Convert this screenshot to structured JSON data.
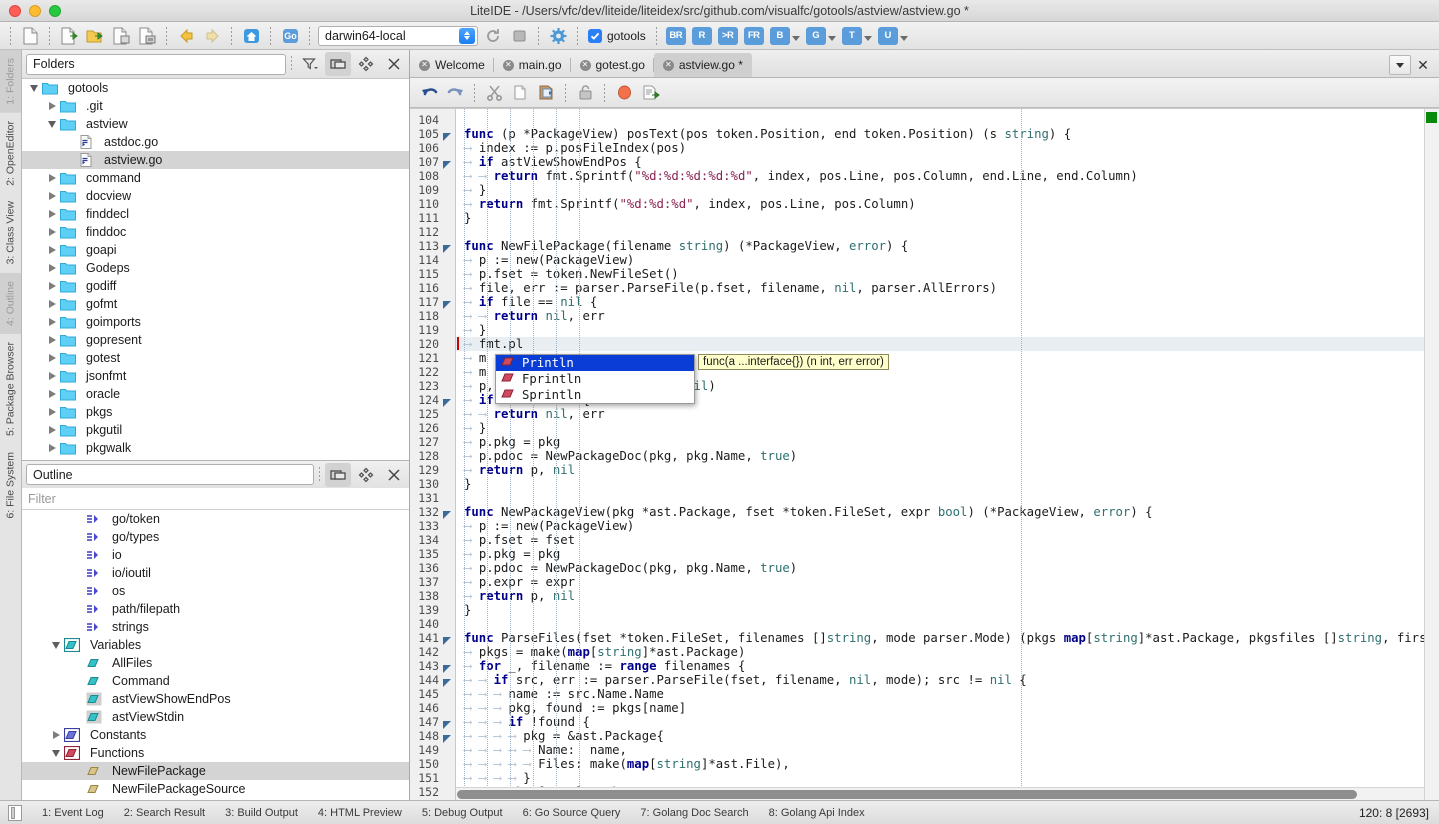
{
  "window": {
    "title": "LiteIDE - /Users/vfc/dev/liteide/liteidex/src/github.com/visualfc/gotools/astview/astview.go *"
  },
  "main_toolbar": {
    "buttons": [
      {
        "name": "new-file",
        "icon": "new-file-icon"
      },
      {
        "name": "open-file",
        "icon": "open-file-icon"
      },
      {
        "name": "open-folder",
        "icon": "open-folder-icon"
      },
      {
        "name": "save-file",
        "icon": "save-file-icon"
      },
      {
        "name": "save-all",
        "icon": "save-all-icon"
      },
      {
        "name": "navigate-back",
        "icon": "arrow-left-icon"
      },
      {
        "name": "navigate-forward",
        "icon": "arrow-right-icon"
      },
      {
        "name": "home",
        "icon": "home-icon"
      },
      {
        "name": "go-tool",
        "icon": "go-icon"
      }
    ],
    "env_combo": {
      "value": "darwin64-local",
      "name": "build-environment-combo"
    },
    "reload_label": "reload",
    "stop_label": "stop",
    "config_label": "configure",
    "gotools_checkbox": {
      "label": "gotools",
      "checked": true
    },
    "go_buttons": [
      {
        "label": "BR",
        "name": "build-run-button",
        "dropdown": false
      },
      {
        "label": "R",
        "name": "run-button",
        "dropdown": false
      },
      {
        "label": ">R",
        "name": "run-cmd-button",
        "dropdown": false
      },
      {
        "label": "FR",
        "name": "file-run-button",
        "dropdown": false
      },
      {
        "label": "B",
        "name": "build-button",
        "dropdown": true
      },
      {
        "label": "G",
        "name": "go-button",
        "dropdown": true
      },
      {
        "label": "T",
        "name": "test-button",
        "dropdown": true
      },
      {
        "label": "U",
        "name": "update-button",
        "dropdown": true
      }
    ]
  },
  "left_tabs": [
    {
      "label": "1: Folders",
      "active": true
    },
    {
      "label": "2: OpenEditor",
      "active": false
    },
    {
      "label": "3: Class View",
      "active": false
    },
    {
      "label": "4: Outline",
      "active": true
    },
    {
      "label": "5: Package Browser",
      "active": false
    },
    {
      "label": "6: File System",
      "active": false
    }
  ],
  "folders_panel": {
    "combo_value": "Folders",
    "toolbar": [
      {
        "name": "filter-button",
        "icon": "filter-icon"
      },
      {
        "name": "split-button",
        "icon": "split-icon",
        "active": true
      },
      {
        "name": "locate-button",
        "icon": "locate-icon"
      },
      {
        "name": "close-button",
        "icon": "close-icon"
      }
    ],
    "tree": [
      {
        "label": "gotools",
        "type": "folder",
        "depth": 0,
        "state": "open",
        "selected": false
      },
      {
        "label": ".git",
        "type": "folder",
        "depth": 1,
        "state": "closed",
        "selected": false
      },
      {
        "label": "astview",
        "type": "folder",
        "depth": 1,
        "state": "open",
        "selected": false
      },
      {
        "label": "astdoc.go",
        "type": "gofile",
        "depth": 2,
        "state": "none",
        "selected": false
      },
      {
        "label": "astview.go",
        "type": "gofile",
        "depth": 2,
        "state": "none",
        "selected": true
      },
      {
        "label": "command",
        "type": "folder",
        "depth": 1,
        "state": "closed",
        "selected": false
      },
      {
        "label": "docview",
        "type": "folder",
        "depth": 1,
        "state": "closed",
        "selected": false
      },
      {
        "label": "finddecl",
        "type": "folder",
        "depth": 1,
        "state": "closed",
        "selected": false
      },
      {
        "label": "finddoc",
        "type": "folder",
        "depth": 1,
        "state": "closed",
        "selected": false
      },
      {
        "label": "goapi",
        "type": "folder",
        "depth": 1,
        "state": "closed",
        "selected": false
      },
      {
        "label": "Godeps",
        "type": "folder",
        "depth": 1,
        "state": "closed",
        "selected": false
      },
      {
        "label": "godiff",
        "type": "folder",
        "depth": 1,
        "state": "closed",
        "selected": false
      },
      {
        "label": "gofmt",
        "type": "folder",
        "depth": 1,
        "state": "closed",
        "selected": false
      },
      {
        "label": "goimports",
        "type": "folder",
        "depth": 1,
        "state": "closed",
        "selected": false
      },
      {
        "label": "gopresent",
        "type": "folder",
        "depth": 1,
        "state": "closed",
        "selected": false
      },
      {
        "label": "gotest",
        "type": "folder",
        "depth": 1,
        "state": "closed",
        "selected": false
      },
      {
        "label": "jsonfmt",
        "type": "folder",
        "depth": 1,
        "state": "closed",
        "selected": false
      },
      {
        "label": "oracle",
        "type": "folder",
        "depth": 1,
        "state": "closed",
        "selected": false
      },
      {
        "label": "pkgs",
        "type": "folder",
        "depth": 1,
        "state": "closed",
        "selected": false
      },
      {
        "label": "pkgutil",
        "type": "folder",
        "depth": 1,
        "state": "closed",
        "selected": false
      },
      {
        "label": "pkgwalk",
        "type": "folder",
        "depth": 1,
        "state": "closed",
        "selected": false
      }
    ]
  },
  "outline_panel": {
    "combo_value": "Outline",
    "filter_placeholder": "Filter",
    "toolbar": [
      {
        "name": "split-button",
        "icon": "split-icon",
        "active": true
      },
      {
        "name": "locate-button",
        "icon": "locate-icon"
      },
      {
        "name": "close-button",
        "icon": "close-icon"
      }
    ],
    "tree": [
      {
        "label": "go/token",
        "type": "import",
        "depth": 2,
        "state": "none",
        "selected": false
      },
      {
        "label": "go/types",
        "type": "import",
        "depth": 2,
        "state": "none",
        "selected": false
      },
      {
        "label": "io",
        "type": "import",
        "depth": 2,
        "state": "none",
        "selected": false
      },
      {
        "label": "io/ioutil",
        "type": "import",
        "depth": 2,
        "state": "none",
        "selected": false
      },
      {
        "label": "os",
        "type": "import",
        "depth": 2,
        "state": "none",
        "selected": false
      },
      {
        "label": "path/filepath",
        "type": "import",
        "depth": 2,
        "state": "none",
        "selected": false
      },
      {
        "label": "strings",
        "type": "import",
        "depth": 2,
        "state": "none",
        "selected": false
      },
      {
        "label": "Variables",
        "type": "group-var",
        "depth": 1,
        "state": "open",
        "selected": false
      },
      {
        "label": "AllFiles",
        "type": "var",
        "depth": 2,
        "state": "none",
        "selected": false
      },
      {
        "label": "Command",
        "type": "var",
        "depth": 2,
        "state": "none",
        "selected": false
      },
      {
        "label": "astViewShowEndPos",
        "type": "var-private",
        "depth": 2,
        "state": "none",
        "selected": false
      },
      {
        "label": "astViewStdin",
        "type": "var-private",
        "depth": 2,
        "state": "none",
        "selected": false
      },
      {
        "label": "Constants",
        "type": "group-const",
        "depth": 1,
        "state": "closed",
        "selected": false
      },
      {
        "label": "Functions",
        "type": "group-func",
        "depth": 1,
        "state": "open",
        "selected": false
      },
      {
        "label": "NewFilePackage",
        "type": "func",
        "depth": 2,
        "state": "none",
        "selected": true
      },
      {
        "label": "NewFilePackageSource",
        "type": "func",
        "depth": 2,
        "state": "none",
        "selected": false
      }
    ]
  },
  "editor": {
    "tabs": [
      {
        "label": "Welcome",
        "active": false,
        "modified": false
      },
      {
        "label": "main.go",
        "active": false,
        "modified": false
      },
      {
        "label": "gotest.go",
        "active": false,
        "modified": false
      },
      {
        "label": "astview.go *",
        "active": true,
        "modified": true
      }
    ],
    "tab_list_button": "tab-list-button",
    "tab_close_button": "close-tab-button",
    "toolbar": [
      {
        "name": "undo-button",
        "icon": "undo-icon"
      },
      {
        "name": "redo-button",
        "icon": "redo-icon"
      },
      {
        "name": "cut-button",
        "icon": "cut-icon"
      },
      {
        "name": "copy-button",
        "icon": "copy-icon"
      },
      {
        "name": "paste-button",
        "icon": "paste-icon"
      },
      {
        "name": "lock-button",
        "icon": "unlock-icon"
      },
      {
        "name": "bookmark-button",
        "icon": "bookmark-icon"
      },
      {
        "name": "export-button",
        "icon": "export-icon"
      }
    ],
    "first_line_number": 104,
    "current_line": 120,
    "lines": [
      {
        "n": 104,
        "text": "",
        "fold": false
      },
      {
        "n": 105,
        "text": "func (p *PackageView) posText(pos token.Position, end token.Position) (s string) {",
        "fold": true
      },
      {
        "n": 106,
        "text": "\tindex := p.posFileIndex(pos)",
        "fold": false
      },
      {
        "n": 107,
        "text": "\tif astViewShowEndPos {",
        "fold": true
      },
      {
        "n": 108,
        "text": "\t\treturn fmt.Sprintf(\"%d:%d:%d:%d:%d\", index, pos.Line, pos.Column, end.Line, end.Column)",
        "fold": false
      },
      {
        "n": 109,
        "text": "\t}",
        "fold": false
      },
      {
        "n": 110,
        "text": "\treturn fmt.Sprintf(\"%d:%d:%d\", index, pos.Line, pos.Column)",
        "fold": false
      },
      {
        "n": 111,
        "text": "}",
        "fold": false
      },
      {
        "n": 112,
        "text": "",
        "fold": false
      },
      {
        "n": 113,
        "text": "func NewFilePackage(filename string) (*PackageView, error) {",
        "fold": true
      },
      {
        "n": 114,
        "text": "\tp := new(PackageView)",
        "fold": false
      },
      {
        "n": 115,
        "text": "\tp.fset = token.NewFileSet()",
        "fold": false
      },
      {
        "n": 116,
        "text": "\tfile, err := parser.ParseFile(p.fset, filename, nil, parser.AllErrors)",
        "fold": false
      },
      {
        "n": 117,
        "text": "\tif file == nil {",
        "fold": true
      },
      {
        "n": 118,
        "text": "\t\treturn nil, err",
        "fold": false
      },
      {
        "n": 119,
        "text": "\t}",
        "fold": false
      },
      {
        "n": 120,
        "text": "\tfmt.pl",
        "fold": false
      },
      {
        "n": 121,
        "text": "\tm := ...",
        "fold": false
      },
      {
        "n": 122,
        "text": "\tm := ...",
        "fold": false
      },
      {
        "n": 123,
        "text": "\tp, err := ....fset, m, nil, nil)",
        "fold": false
      },
      {
        "n": 124,
        "text": "\tif err != nil {",
        "fold": true
      },
      {
        "n": 125,
        "text": "\t\treturn nil, err",
        "fold": false
      },
      {
        "n": 126,
        "text": "\t}",
        "fold": false
      },
      {
        "n": 127,
        "text": "\tp.pkg = pkg",
        "fold": false
      },
      {
        "n": 128,
        "text": "\tp.pdoc = NewPackageDoc(pkg, pkg.Name, true)",
        "fold": false
      },
      {
        "n": 129,
        "text": "\treturn p, nil",
        "fold": false
      },
      {
        "n": 130,
        "text": "}",
        "fold": false
      },
      {
        "n": 131,
        "text": "",
        "fold": false
      },
      {
        "n": 132,
        "text": "func NewPackageView(pkg *ast.Package, fset *token.FileSet, expr bool) (*PackageView, error) {",
        "fold": true
      },
      {
        "n": 133,
        "text": "\tp := new(PackageView)",
        "fold": false
      },
      {
        "n": 134,
        "text": "\tp.fset = fset",
        "fold": false
      },
      {
        "n": 135,
        "text": "\tp.pkg = pkg",
        "fold": false
      },
      {
        "n": 136,
        "text": "\tp.pdoc = NewPackageDoc(pkg, pkg.Name, true)",
        "fold": false
      },
      {
        "n": 137,
        "text": "\tp.expr = expr",
        "fold": false
      },
      {
        "n": 138,
        "text": "\treturn p, nil",
        "fold": false
      },
      {
        "n": 139,
        "text": "}",
        "fold": false
      },
      {
        "n": 140,
        "text": "",
        "fold": false
      },
      {
        "n": 141,
        "text": "func ParseFiles(fset *token.FileSet, filenames []string, mode parser.Mode) (pkgs map[string]*ast.Package, pkgsfiles []string, first e",
        "fold": true
      },
      {
        "n": 142,
        "text": "\tpkgs = make(map[string]*ast.Package)",
        "fold": false
      },
      {
        "n": 143,
        "text": "\tfor _, filename := range filenames {",
        "fold": true
      },
      {
        "n": 144,
        "text": "\t\tif src, err := parser.ParseFile(fset, filename, nil, mode); src != nil {",
        "fold": true
      },
      {
        "n": 145,
        "text": "\t\t\tname := src.Name.Name",
        "fold": false
      },
      {
        "n": 146,
        "text": "\t\t\tpkg, found := pkgs[name]",
        "fold": false
      },
      {
        "n": 147,
        "text": "\t\t\tif !found {",
        "fold": true
      },
      {
        "n": 148,
        "text": "\t\t\t\tpkg = &ast.Package{",
        "fold": true
      },
      {
        "n": 149,
        "text": "\t\t\t\t\tName:  name,",
        "fold": false
      },
      {
        "n": 150,
        "text": "\t\t\t\t\tFiles: make(map[string]*ast.File),",
        "fold": false
      },
      {
        "n": 151,
        "text": "\t\t\t\t}",
        "fold": false
      },
      {
        "n": 152,
        "text": "\t\t\tpkgs[name] = pkg",
        "fold": false
      }
    ],
    "autocomplete": {
      "items": [
        {
          "label": "Println",
          "selected": true
        },
        {
          "label": "Fprintln",
          "selected": false
        },
        {
          "label": "Sprintln",
          "selected": false
        }
      ],
      "tooltip": "func(a ...interface{}) (n int, err error)"
    }
  },
  "status_bar": {
    "items": [
      {
        "label": "1: Event Log"
      },
      {
        "label": "2: Search Result"
      },
      {
        "label": "3: Build Output"
      },
      {
        "label": "4: HTML Preview"
      },
      {
        "label": "5: Debug Output"
      },
      {
        "label": "6: Go Source Query"
      },
      {
        "label": "7: Golang Doc Search"
      },
      {
        "label": "8: Golang Api Index"
      }
    ],
    "position": "120:  8 [2693]"
  },
  "colors": {
    "accent": "#2b7ff5",
    "selection": "#0a3dd6",
    "tooltip_bg": "#ffffcc",
    "marker_green": "#0a8a0a"
  }
}
